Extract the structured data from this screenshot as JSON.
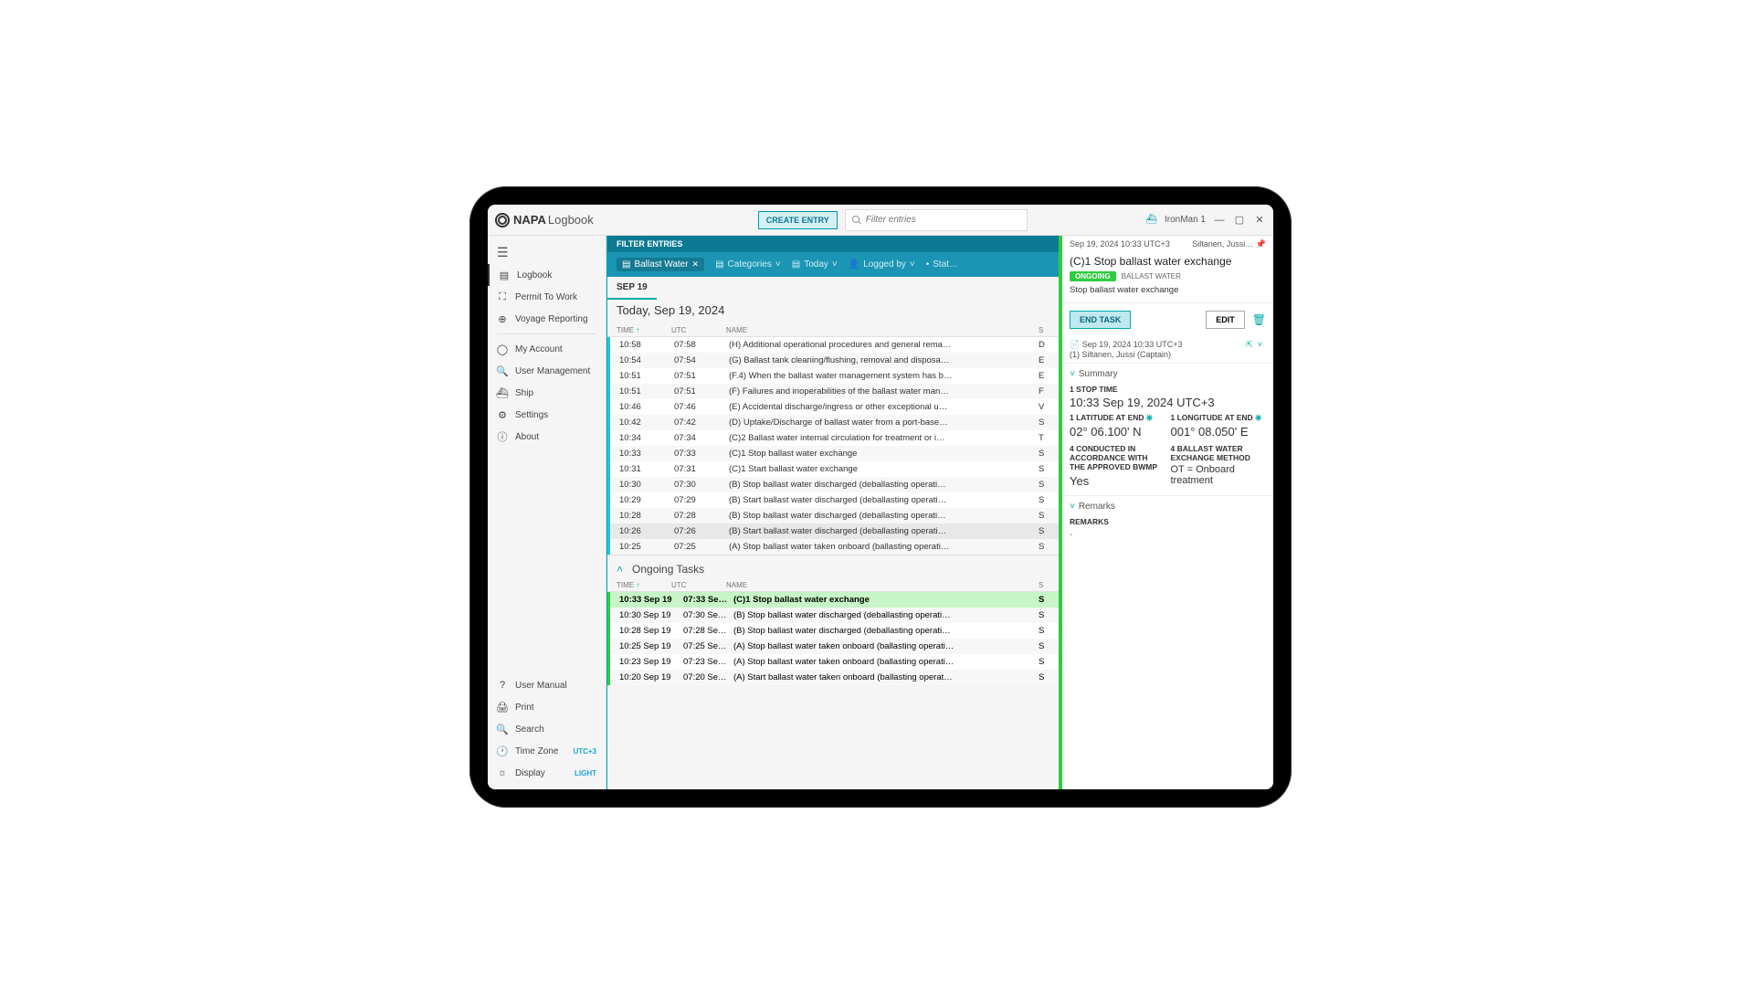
{
  "app": {
    "brand": "NAPA",
    "sub": "Logbook"
  },
  "topbar": {
    "create": "CREATE ENTRY",
    "search_ph": "Filter entries",
    "ship": "IronMan 1"
  },
  "sidebar": {
    "top": [
      {
        "icon": "☰",
        "label": ""
      },
      {
        "icon": "▤",
        "label": "Logbook",
        "active": true
      },
      {
        "icon": "⛶",
        "label": "Permit To Work"
      },
      {
        "icon": "⊕",
        "label": "Voyage Reporting"
      }
    ],
    "mid": [
      {
        "icon": "◯",
        "label": "My Account"
      },
      {
        "icon": "🔍",
        "label": "User Management"
      },
      {
        "icon": "⛴",
        "label": "Ship"
      },
      {
        "icon": "⚙",
        "label": "Settings"
      },
      {
        "icon": "ⓘ",
        "label": "About"
      }
    ],
    "bottom": [
      {
        "icon": "?",
        "label": "User Manual",
        "tag": ""
      },
      {
        "icon": "🖨",
        "label": "Print",
        "tag": ""
      },
      {
        "icon": "🔍",
        "label": "Search",
        "tag": ""
      },
      {
        "icon": "🕐",
        "label": "Time Zone",
        "tag": "UTC+3"
      },
      {
        "icon": "☼",
        "label": "Display",
        "tag": "LIGHT"
      }
    ]
  },
  "filters": {
    "header": "FILTER ENTRIES",
    "chips": [
      {
        "label": "Ballast Water",
        "active": true,
        "close": true,
        "icon": "▤"
      },
      {
        "label": "Categories",
        "drop": true,
        "icon": "▤"
      },
      {
        "label": "Today",
        "drop": true,
        "icon": "▤"
      },
      {
        "label": "Logged by",
        "drop": true,
        "icon": "👤"
      },
      {
        "label": "Stat…",
        "icon": "•"
      }
    ]
  },
  "dateTab": "SEP 19",
  "todayLabel": "Today, Sep 19, 2024",
  "cols": {
    "time": "TIME",
    "utc": "UTC",
    "name": "NAME",
    "s": "S"
  },
  "entries": [
    {
      "t": "10:58",
      "u": "07:58",
      "n": "(H) Additional operational procedures and general rema…",
      "s": "D"
    },
    {
      "t": "10:54",
      "u": "07:54",
      "n": "(G) Ballast tank cleaning/flushing, removal and disposa…",
      "s": "E"
    },
    {
      "t": "10:51",
      "u": "07:51",
      "n": "(F.4) When the ballast water management system has b…",
      "s": "E"
    },
    {
      "t": "10:51",
      "u": "07:51",
      "n": "(F) Failures and inoperabilities of the ballast water man…",
      "s": "F"
    },
    {
      "t": "10:46",
      "u": "07:46",
      "n": "(E) Accidental discharge/ingress or other exceptional u…",
      "s": "V"
    },
    {
      "t": "10:42",
      "u": "07:42",
      "n": "(D) Uptake/Discharge of ballast water from a port-base…",
      "s": "S"
    },
    {
      "t": "10:34",
      "u": "07:34",
      "n": "(C)2 Ballast water internal circulation for treatment or i…",
      "s": "T"
    },
    {
      "t": "10:33",
      "u": "07:33",
      "n": "(C)1 Stop ballast water exchange",
      "s": "S"
    },
    {
      "t": "10:31",
      "u": "07:31",
      "n": "(C)1 Start ballast water exchange",
      "s": "S"
    },
    {
      "t": "10:30",
      "u": "07:30",
      "n": "(B) Stop ballast water discharged (deballasting operati…",
      "s": "S"
    },
    {
      "t": "10:29",
      "u": "07:29",
      "n": "(B) Start ballast water discharged (deballasting operati…",
      "s": "S"
    },
    {
      "t": "10:28",
      "u": "07:28",
      "n": "(B) Stop ballast water discharged (deballasting operati…",
      "s": "S"
    },
    {
      "t": "10:26",
      "u": "07:26",
      "n": "(B) Start ballast water discharged (deballasting operati…",
      "s": "S",
      "sel": true
    },
    {
      "t": "10:25",
      "u": "07:25",
      "n": "(A) Stop ballast water taken onboard (ballasting operati…",
      "s": "S"
    }
  ],
  "ongoing": {
    "title": "Ongoing Tasks",
    "rows": [
      {
        "t": "10:33 Sep 19",
        "u": "07:33 Se…",
        "n": "(C)1 Stop ballast water exchange",
        "s": "S",
        "hl": true
      },
      {
        "t": "10:30 Sep 19",
        "u": "07:30 Se…",
        "n": "(B) Stop ballast water discharged (deballasting operati…",
        "s": "S"
      },
      {
        "t": "10:28 Sep 19",
        "u": "07:28 Se…",
        "n": "(B) Stop ballast water discharged (deballasting operati…",
        "s": "S"
      },
      {
        "t": "10:25 Sep 19",
        "u": "07:25 Se…",
        "n": "(A) Stop ballast water taken onboard (ballasting operati…",
        "s": "S"
      },
      {
        "t": "10:23 Sep 19",
        "u": "07:23 Se…",
        "n": "(A) Stop ballast water taken onboard (ballasting operati…",
        "s": "S"
      },
      {
        "t": "10:20 Sep 19",
        "u": "07:20 Se…",
        "n": "(A) Start ballast water taken onboard (ballasting operat…",
        "s": "S"
      }
    ]
  },
  "detail": {
    "meta_ts": "Sep 19, 2024 10:33 UTC+3",
    "meta_auth": "Siltanen, Jussi…",
    "title": "(C)1 Stop ballast water exchange",
    "tag_ongoing": "ONGOING",
    "tag_cat": "BALLAST WATER",
    "desc": "Stop ballast water exchange",
    "end": "END TASK",
    "edit": "EDIT",
    "sub_ts": "Sep 19, 2024 10:33 UTC+3",
    "sub_auth": "(1)  Siltanen, Jussi (Captain)",
    "summary": "Summary",
    "stop_lbl": "1 STOP TIME",
    "stop_val": "10:33 Sep 19, 2024 UTC+3",
    "lat_lbl": "1 LATITUDE AT END",
    "lat_val": "02° 06.100' N",
    "lon_lbl": "1 LONGITUDE AT END",
    "lon_val": "001° 08.050' E",
    "q4_lbl": "4 CONDUCTED IN ACCORDANCE WITH THE APPROVED BWMP",
    "q4_val": "Yes",
    "q4b_lbl": "4 BALLAST WATER EXCHANGE METHOD",
    "q4b_val": "OT = Onboard treatment",
    "remarks_h": "Remarks",
    "remarks_lbl": "REMARKS",
    "remarks_val": "-"
  }
}
